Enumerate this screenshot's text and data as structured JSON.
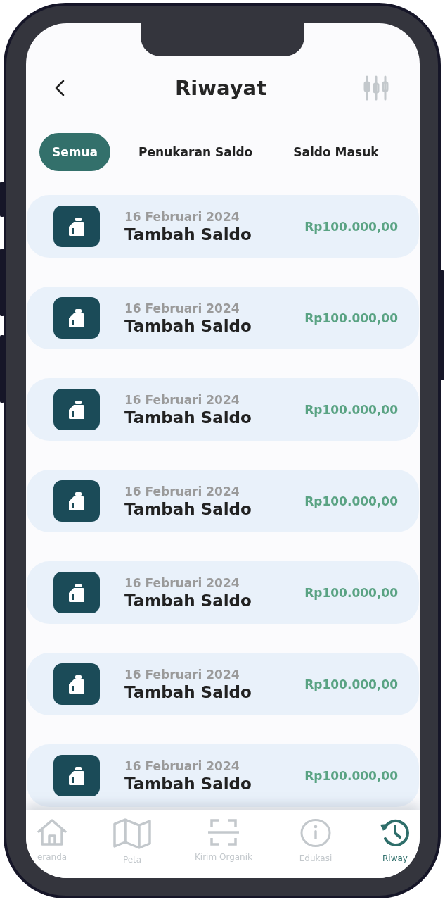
{
  "header": {
    "title": "Riwayat"
  },
  "tabs": [
    {
      "label": "Semua",
      "selected": true
    },
    {
      "label": "Penukaran Saldo",
      "selected": false
    },
    {
      "label": "Saldo Masuk",
      "selected": false
    }
  ],
  "transactions": [
    {
      "date": "16 Februari 2024",
      "title": "Tambah Saldo",
      "amount": "Rp100.000,00"
    },
    {
      "date": "16 Februari 2024",
      "title": "Tambah Saldo",
      "amount": "Rp100.000,00"
    },
    {
      "date": "16 Februari 2024",
      "title": "Tambah Saldo",
      "amount": "Rp100.000,00"
    },
    {
      "date": "16 Februari 2024",
      "title": "Tambah Saldo",
      "amount": "Rp100.000,00"
    },
    {
      "date": "16 Februari 2024",
      "title": "Tambah Saldo",
      "amount": "Rp100.000,00"
    },
    {
      "date": "16 Februari 2024",
      "title": "Tambah Saldo",
      "amount": "Rp100.000,00"
    },
    {
      "date": "16 Februari 2024",
      "title": "Tambah Saldo",
      "amount": "Rp100.000,00"
    }
  ],
  "bottom_nav": [
    {
      "kind": "home",
      "label": "eranda",
      "selected": false
    },
    {
      "kind": "map",
      "label": "Peta",
      "selected": false
    },
    {
      "kind": "scan",
      "label": "Kirim Organik",
      "selected": false
    },
    {
      "kind": "info",
      "label": "Edukasi",
      "selected": false
    },
    {
      "kind": "history",
      "label": "Riway",
      "selected": true
    }
  ]
}
